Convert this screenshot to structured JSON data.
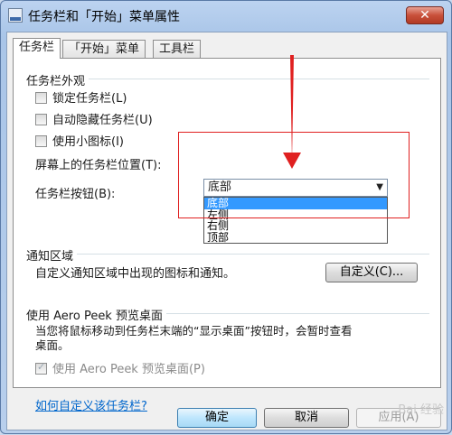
{
  "window": {
    "title": "任务栏和「开始」菜单属性",
    "close_symbol": "✕"
  },
  "tabs": [
    {
      "label": "任务栏"
    },
    {
      "label": "「开始」菜单"
    },
    {
      "label": "工具栏"
    }
  ],
  "appearance": {
    "title": "任务栏外观",
    "lock_label": "锁定任务栏(L)",
    "autohide_label": "自动隐藏任务栏(U)",
    "small_icons_label": "使用小图标(I)",
    "location_label": "屏幕上的任务栏位置(T):",
    "location_value": "底部",
    "location_options": [
      "底部",
      "左侧",
      "右侧",
      "顶部"
    ],
    "buttons_label": "任务栏按钮(B):"
  },
  "notification": {
    "title": "通知区域",
    "description": "自定义通知区域中出现的图标和通知。",
    "customize_button": "自定义(C)..."
  },
  "aero_peek": {
    "title": "使用 Aero Peek 预览桌面",
    "description_line1": "当您将鼠标移动到任务栏末端的“显示桌面”按钮时，会暂时查看",
    "description_line2": "桌面。",
    "checkbox_label": "使用 Aero Peek 预览桌面(P)"
  },
  "help_link": "如何自定义该任务栏?",
  "footer": {
    "ok": "确定",
    "cancel": "取消",
    "apply": "应用(A)"
  },
  "watermark": "Bai 经验",
  "colors": {
    "annotation": "#e02020",
    "selection": "#3399ff",
    "link": "#0066cc"
  }
}
